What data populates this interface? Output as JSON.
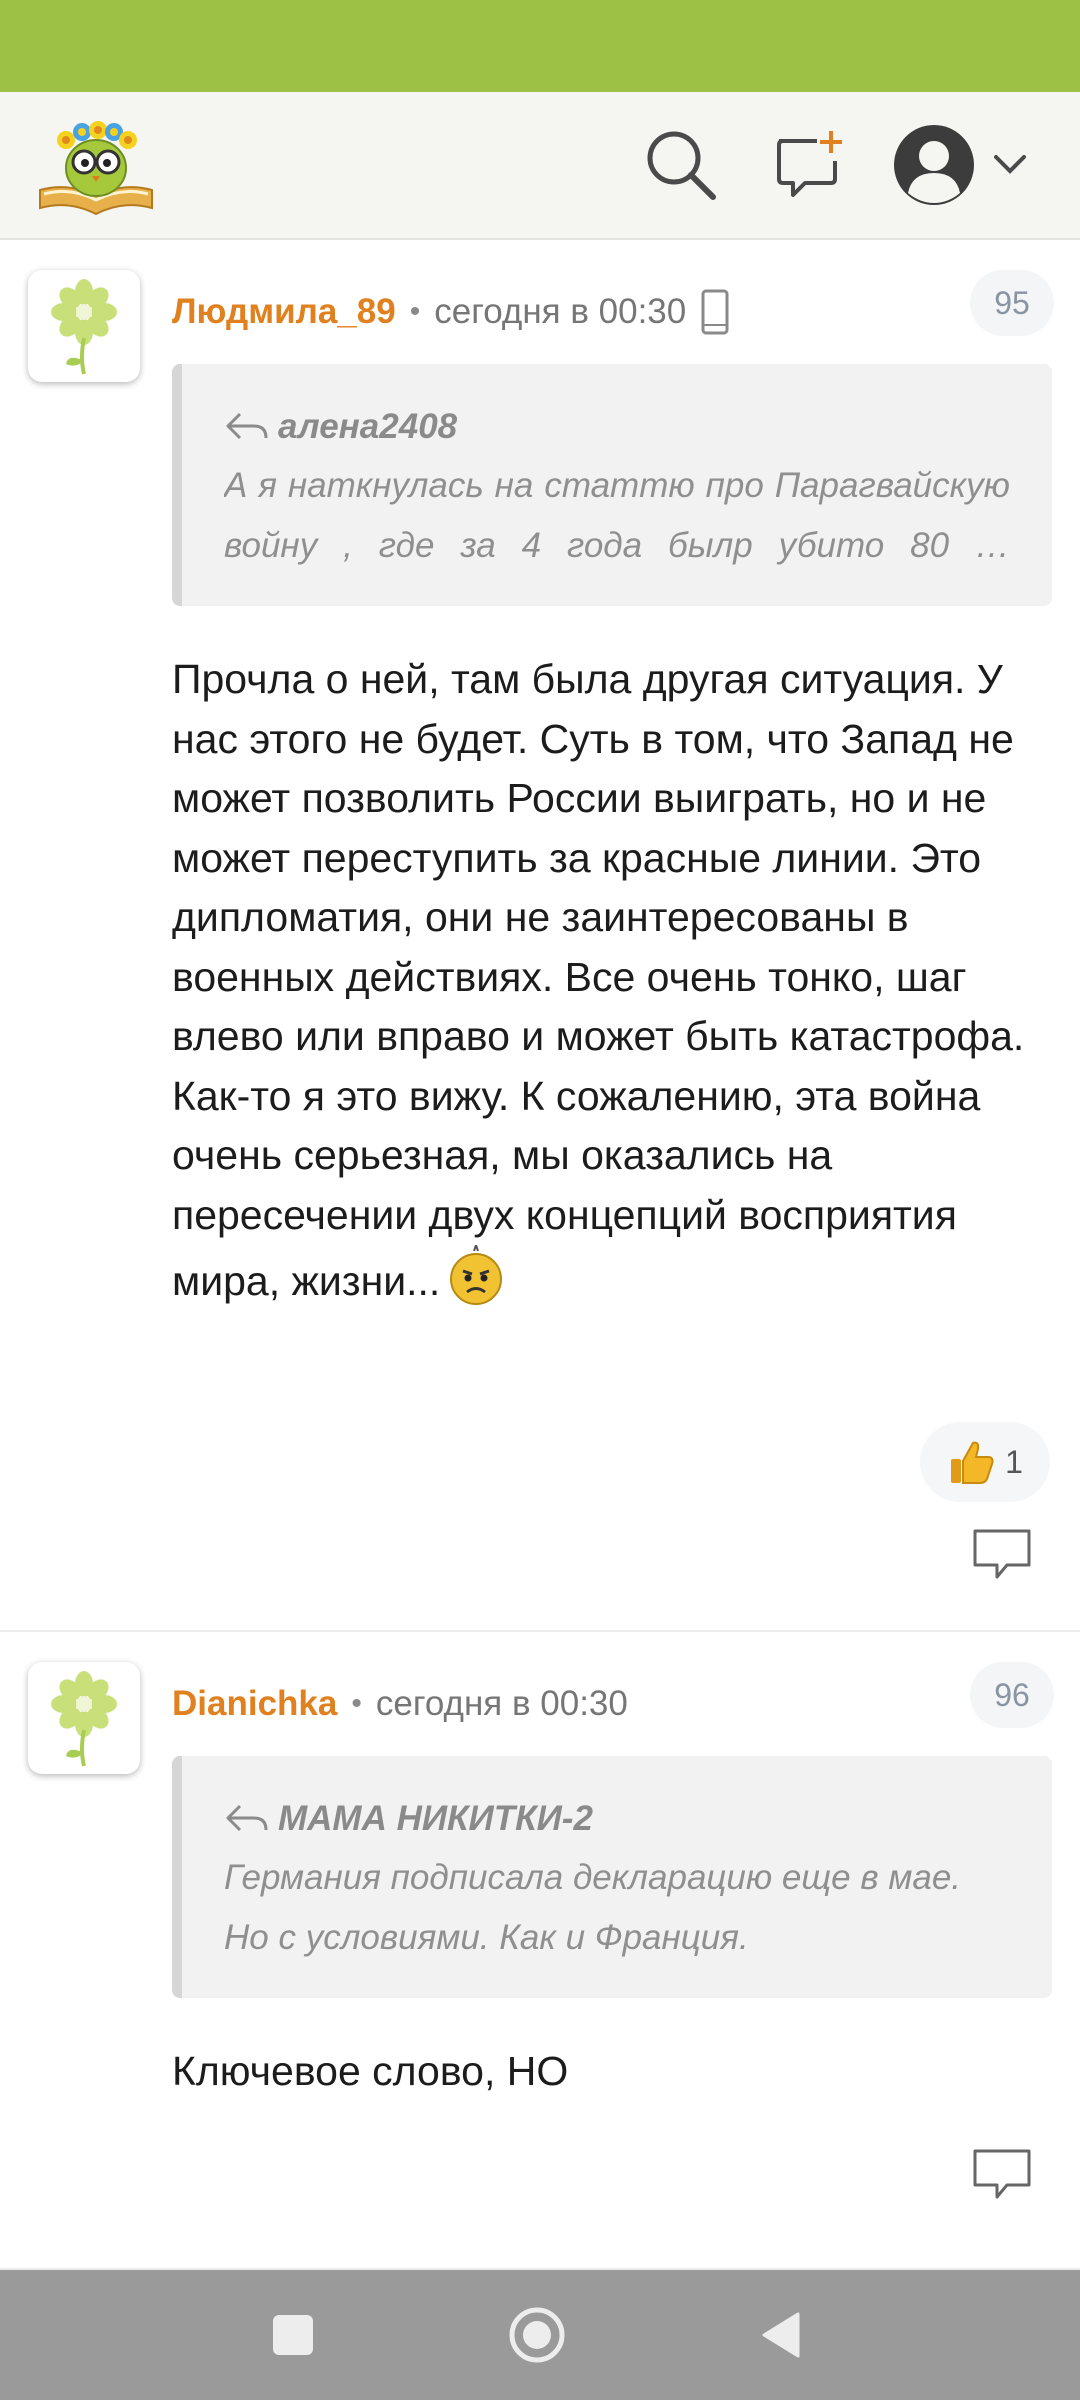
{
  "header": {
    "logo_icon": "owl-book-logo-icon",
    "search_icon": "search-icon",
    "new_post_icon": "new-message-plus-icon",
    "profile_icon": "user-avatar-icon",
    "profile_menu_icon": "chevron-down-icon"
  },
  "colors": {
    "status_bar": "#9dc145",
    "author": "#e0801e",
    "nav_bar": "#9a9a9a"
  },
  "comments": [
    {
      "number": "95",
      "author": "Людмила_89",
      "separator": "•",
      "time": "сегодня в 00:30",
      "device_icon": "mobile-phone-icon",
      "quote": {
        "author": "алена2408",
        "line1": "А я наткнулась на статтю про Парагвайскую",
        "line2": "войну , где за 4 года былр убито 80 …"
      },
      "text": "Прочла о ней, там была другая ситуация. У нас этого не будет. Суть в том, что Запад не может позволить России выиграть, но и не может переступить за красные линии. Это дипломатия, они не заинтересованы в военных действиях. Все очень тонко, шаг влево или вправо и может быть катастрофа. Как-то я это вижу. К сожалению, эта война очень серьезная, мы оказались на пересечении двух концепций восприятия мира, жизни...",
      "emoji_icon": "frowning-smiley-icon",
      "likes": "1",
      "like_icon": "thumbs-up-icon",
      "reply_icon": "reply-bubble-icon"
    },
    {
      "number": "96",
      "author": "Dianichka",
      "separator": "•",
      "time": "сегодня в 00:30",
      "quote": {
        "author": "МАМА НИКИТКИ-2",
        "line1": "Германия подписала декларацию еще в мае.",
        "line2": "Но с условиями. Как и Франция."
      },
      "text": "Ключевое слово, НО",
      "reply_icon": "reply-bubble-icon"
    }
  ],
  "navigation": {
    "recent_icon": "square-recent-apps-icon",
    "home_icon": "circle-home-icon",
    "back_icon": "triangle-back-icon"
  }
}
